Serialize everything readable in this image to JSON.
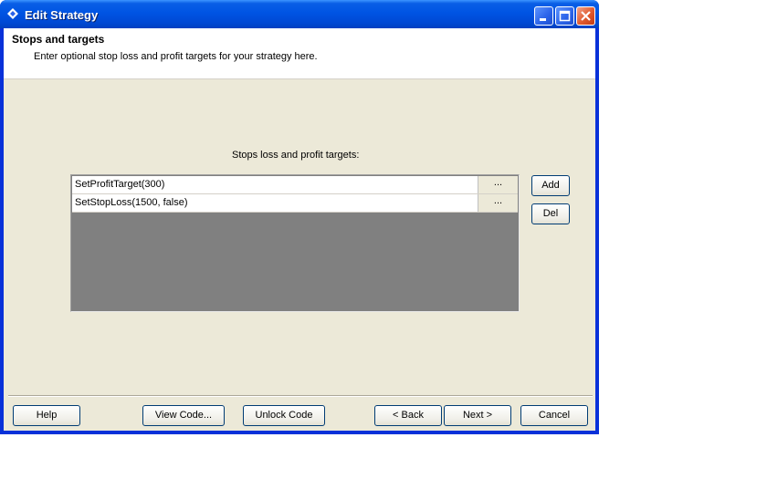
{
  "window": {
    "title": "Edit Strategy"
  },
  "header": {
    "title": "Stops and targets",
    "subtitle": "Enter optional stop loss and profit targets for your strategy here."
  },
  "list": {
    "caption": "Stops loss and profit targets:",
    "rows": [
      {
        "text": "SetProfitTarget(300)",
        "button": "..."
      },
      {
        "text": "SetStopLoss(1500, false)",
        "button": "..."
      }
    ]
  },
  "side_buttons": {
    "add": "Add",
    "del": "Del"
  },
  "footer": {
    "help": "Help",
    "view_code": "View Code...",
    "unlock_code": "Unlock Code",
    "back": "< Back",
    "next": "Next >",
    "cancel": "Cancel"
  },
  "colors": {
    "titlebar": "#0054e3",
    "dialog_bg": "#ece9d8",
    "list_bg": "#808080",
    "close_button": "#e05a2e"
  }
}
